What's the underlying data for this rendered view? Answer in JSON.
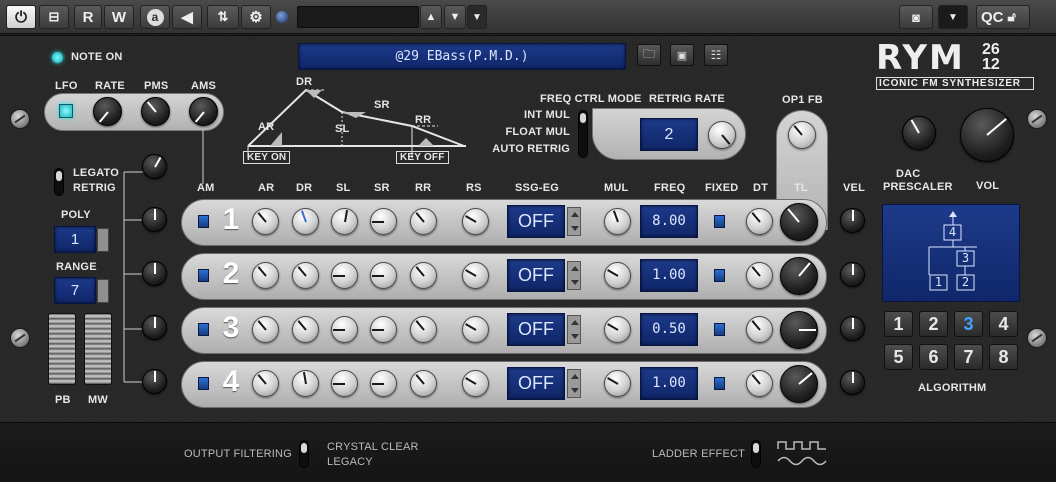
{
  "toolbar": {
    "read_label": "R",
    "write_label": "W",
    "auto_label": "a",
    "qc_label": "QC"
  },
  "header": {
    "note_on_label": "NOTE ON",
    "preset_name": "@29 EBass(P.M.D.)",
    "logo_text": "RYM",
    "logo_number_top": "26",
    "logo_number_bottom": "12",
    "tagline": "ICONIC FM SYNTHESIZER"
  },
  "lfo": {
    "lfo_label": "LFO",
    "rate_label": "RATE",
    "pms_label": "PMS",
    "ams_label": "AMS"
  },
  "envelope": {
    "dr": "DR",
    "ar": "AR",
    "sr": "SR",
    "sl": "SL",
    "rr": "RR",
    "key_on": "KEY ON",
    "key_off": "KEY OFF"
  },
  "freq_ctrl": {
    "title": "FREQ CTRL MODE",
    "options": [
      "INT MUL",
      "FLOAT MUL",
      "AUTO RETRIG"
    ],
    "retrig_label": "RETRIG RATE",
    "retrig_value": "2",
    "op1_fb_label": "OP1 FB"
  },
  "master": {
    "dac_label_1": "DAC",
    "dac_label_2": "PRESCALER",
    "vol_label": "VOL"
  },
  "voice": {
    "legato_label": "LEGATO",
    "retrig_label": "RETRIG",
    "poly_label": "POLY",
    "poly_value": "1",
    "range_label": "RANGE",
    "range_value": "7",
    "pb_label": "PB",
    "mw_label": "MW"
  },
  "columns": {
    "am": "AM",
    "ar": "AR",
    "dr": "DR",
    "sl": "SL",
    "sr": "SR",
    "rr": "RR",
    "rs": "RS",
    "ssg": "SSG-EG",
    "mul": "MUL",
    "freq": "FREQ",
    "fixed": "FIXED",
    "dt": "DT",
    "tl": "TL",
    "vel": "VEL"
  },
  "operators": [
    {
      "num": "1",
      "ssg": "OFF",
      "freq": "8.00"
    },
    {
      "num": "2",
      "ssg": "OFF",
      "freq": "1.00"
    },
    {
      "num": "3",
      "ssg": "OFF",
      "freq": "0.50"
    },
    {
      "num": "4",
      "ssg": "OFF",
      "freq": "1.00"
    }
  ],
  "algorithm": {
    "label": "ALGORITHM",
    "selected": 3,
    "buttons": [
      "1",
      "2",
      "3",
      "4",
      "5",
      "6",
      "7",
      "8"
    ],
    "diagram_ops": [
      "4",
      "3",
      "1",
      "2"
    ]
  },
  "footer": {
    "output_filtering_label": "OUTPUT FILTERING",
    "crystal_clear": "CRYSTAL CLEAR",
    "legacy": "LEGACY",
    "ladder_label": "LADDER EFFECT"
  },
  "colors": {
    "lcd_blue": "#1d3a8a",
    "accent_blue": "#3fa3ff",
    "led_cyan": "#2fe3e8"
  }
}
